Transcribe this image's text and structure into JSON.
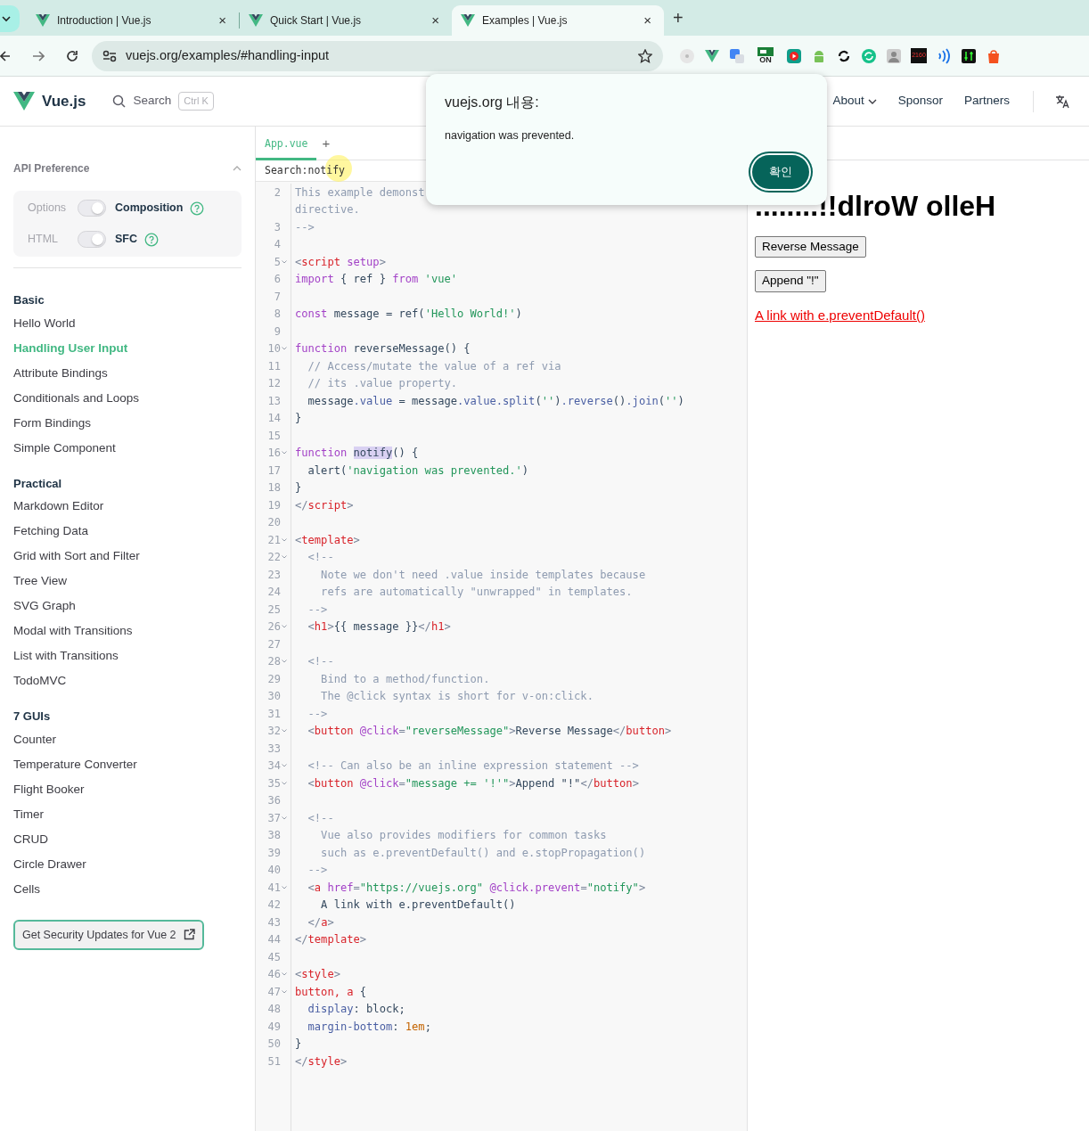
{
  "browser": {
    "tabs": [
      {
        "title": "Introduction | Vue.js",
        "selected": false
      },
      {
        "title": "Quick Start | Vue.js",
        "selected": false
      },
      {
        "title": "Examples | Vue.js",
        "selected": true
      }
    ],
    "new_tab": "+",
    "close": "×",
    "url": "vuejs.org/examples/#handling-input",
    "extension_labels": [
      "ON",
      "2160"
    ]
  },
  "header": {
    "brand": "Vue.js",
    "search": "Search",
    "shortcut": "Ctrl K",
    "nav": [
      {
        "label": "About",
        "dropdown": true
      },
      {
        "label": "Sponsor",
        "dropdown": false
      },
      {
        "label": "Partners",
        "dropdown": false
      }
    ]
  },
  "sidebar": {
    "pref_title": "API Preference",
    "prefs": [
      {
        "left": "Options",
        "right": "Composition",
        "right_selected": true
      },
      {
        "left": "HTML",
        "right": "SFC",
        "right_selected": true
      }
    ],
    "sections": [
      {
        "title": "Basic",
        "items": [
          {
            "label": "Hello World",
            "selected": false
          },
          {
            "label": "Handling User Input",
            "selected": true
          },
          {
            "label": "Attribute Bindings",
            "selected": false
          },
          {
            "label": "Conditionals and Loops",
            "selected": false
          },
          {
            "label": "Form Bindings",
            "selected": false
          },
          {
            "label": "Simple Component",
            "selected": false
          }
        ]
      },
      {
        "title": "Practical",
        "items": [
          {
            "label": "Markdown Editor",
            "selected": false
          },
          {
            "label": "Fetching Data",
            "selected": false
          },
          {
            "label": "Grid with Sort and Filter",
            "selected": false
          },
          {
            "label": "Tree View",
            "selected": false
          },
          {
            "label": "SVG Graph",
            "selected": false
          },
          {
            "label": "Modal with Transitions",
            "selected": false
          },
          {
            "label": "List with Transitions",
            "selected": false
          },
          {
            "label": "TodoMVC",
            "selected": false
          }
        ]
      },
      {
        "title": "7 GUIs",
        "items": [
          {
            "label": "Counter",
            "selected": false
          },
          {
            "label": "Temperature Converter",
            "selected": false
          },
          {
            "label": "Flight Booker",
            "selected": false
          },
          {
            "label": "Timer",
            "selected": false
          },
          {
            "label": "CRUD",
            "selected": false
          },
          {
            "label": "Circle Drawer",
            "selected": false
          },
          {
            "label": "Cells",
            "selected": false
          }
        ]
      }
    ],
    "security_button": "Get Security Updates for Vue 2"
  },
  "editor": {
    "tabs": [
      {
        "label": "App.vue",
        "selected": true
      }
    ],
    "add_tab": "+",
    "search_label": "Search:",
    "search_value": "notify",
    "lines": [
      {
        "n": "2",
        "fold": false,
        "tokens": [
          {
            "kind": "c",
            "text": "This example demonst"
          }
        ]
      },
      {
        "fold": false,
        "tokens": [
          {
            "kind": "c",
            "text": "directive."
          }
        ]
      },
      {
        "n": "3",
        "fold": false,
        "tokens": [
          {
            "kind": "c",
            "text": "-->"
          }
        ]
      },
      {
        "n": "4",
        "fold": false
      },
      {
        "n": "5",
        "fold": true,
        "tokens": [
          {
            "kind": "pu",
            "text": "<"
          },
          {
            "kind": "tag",
            "text": "script"
          },
          {
            "kind": "at",
            "text": " setup"
          },
          {
            "kind": "pu",
            "text": ">"
          }
        ]
      },
      {
        "n": "6",
        "fold": false,
        "tokens": [
          {
            "kind": "k",
            "text": "import"
          },
          {
            "kind": "p",
            "text": " { ref } "
          },
          {
            "kind": "k",
            "text": "from"
          },
          {
            "kind": "s",
            "text": " 'vue'"
          }
        ]
      },
      {
        "n": "7",
        "fold": false
      },
      {
        "n": "8",
        "fold": false,
        "tokens": [
          {
            "kind": "k",
            "text": "const"
          },
          {
            "kind": "p",
            "text": " message = ref("
          },
          {
            "kind": "s",
            "text": "'Hello World!'"
          },
          {
            "kind": "p",
            "text": ")"
          }
        ]
      },
      {
        "n": "9",
        "fold": false
      },
      {
        "n": "10",
        "fold": true,
        "tokens": [
          {
            "kind": "k",
            "text": "function"
          },
          {
            "kind": "p",
            "text": " reverseMessage() {"
          }
        ]
      },
      {
        "n": "11",
        "fold": false,
        "tokens": [
          {
            "kind": "c",
            "text": "  // Access/mutate the value of a ref via"
          }
        ]
      },
      {
        "n": "12",
        "fold": false,
        "tokens": [
          {
            "kind": "c",
            "text": "  // its .value property."
          }
        ]
      },
      {
        "n": "13",
        "fold": false,
        "tokens": [
          {
            "kind": "p",
            "text": "  message"
          },
          {
            "kind": "pr",
            "text": ".value"
          },
          {
            "kind": "p",
            "text": " = message"
          },
          {
            "kind": "pr",
            "text": ".value.split"
          },
          {
            "kind": "p",
            "text": "("
          },
          {
            "kind": "s",
            "text": "''"
          },
          {
            "kind": "p",
            "text": ")"
          },
          {
            "kind": "pr",
            "text": ".reverse"
          },
          {
            "kind": "p",
            "text": "()"
          },
          {
            "kind": "pr",
            "text": ".join"
          },
          {
            "kind": "p",
            "text": "("
          },
          {
            "kind": "s",
            "text": "''"
          },
          {
            "kind": "p",
            "text": ")"
          }
        ]
      },
      {
        "n": "14",
        "fold": false,
        "tokens": [
          {
            "kind": "p",
            "text": "}"
          }
        ]
      },
      {
        "n": "15",
        "fold": false
      },
      {
        "n": "16",
        "fold": true,
        "tokens": [
          {
            "kind": "k",
            "text": "function "
          },
          {
            "kind": "m",
            "text": "notify"
          },
          {
            "kind": "p",
            "text": "() {"
          }
        ]
      },
      {
        "n": "17",
        "fold": false,
        "tokens": [
          {
            "kind": "p",
            "text": "  alert("
          },
          {
            "kind": "s",
            "text": "'navigation was prevented.'"
          },
          {
            "kind": "p",
            "text": ")"
          }
        ]
      },
      {
        "n": "18",
        "fold": false,
        "tokens": [
          {
            "kind": "p",
            "text": "}"
          }
        ]
      },
      {
        "n": "19",
        "fold": false,
        "tokens": [
          {
            "kind": "pu",
            "text": "</"
          },
          {
            "kind": "tag",
            "text": "script"
          },
          {
            "kind": "pu",
            "text": ">"
          }
        ]
      },
      {
        "n": "20",
        "fold": false
      },
      {
        "n": "21",
        "fold": true,
        "tokens": [
          {
            "kind": "pu",
            "text": "<"
          },
          {
            "kind": "tag",
            "text": "template"
          },
          {
            "kind": "pu",
            "text": ">"
          }
        ]
      },
      {
        "n": "22",
        "fold": true,
        "tokens": [
          {
            "kind": "c",
            "text": "  <!--"
          }
        ]
      },
      {
        "n": "23",
        "fold": false,
        "tokens": [
          {
            "kind": "c",
            "text": "    Note we don't need .value inside templates because"
          }
        ]
      },
      {
        "n": "24",
        "fold": false,
        "tokens": [
          {
            "kind": "c",
            "text": "    refs are automatically \"unwrapped\" in templates."
          }
        ]
      },
      {
        "n": "25",
        "fold": false,
        "tokens": [
          {
            "kind": "c",
            "text": "  -->"
          }
        ]
      },
      {
        "n": "26",
        "fold": true,
        "tokens": [
          {
            "kind": "pu",
            "text": "  <"
          },
          {
            "kind": "tag",
            "text": "h1"
          },
          {
            "kind": "pu",
            "text": ">"
          },
          {
            "kind": "p",
            "text": "{{ message }}"
          },
          {
            "kind": "pu",
            "text": "</"
          },
          {
            "kind": "tag",
            "text": "h1"
          },
          {
            "kind": "pu",
            "text": ">"
          }
        ]
      },
      {
        "n": "27",
        "fold": false
      },
      {
        "n": "28",
        "fold": true,
        "tokens": [
          {
            "kind": "c",
            "text": "  <!--"
          }
        ]
      },
      {
        "n": "29",
        "fold": false,
        "tokens": [
          {
            "kind": "c",
            "text": "    Bind to a method/function."
          }
        ]
      },
      {
        "n": "30",
        "fold": false,
        "tokens": [
          {
            "kind": "c",
            "text": "    The @click syntax is short for v-on:click."
          }
        ]
      },
      {
        "n": "31",
        "fold": false,
        "tokens": [
          {
            "kind": "c",
            "text": "  -->"
          }
        ]
      },
      {
        "n": "32",
        "fold": true,
        "tokens": [
          {
            "kind": "pu",
            "text": "  <"
          },
          {
            "kind": "tag",
            "text": "button"
          },
          {
            "kind": "at",
            "text": " @click"
          },
          {
            "kind": "pu",
            "text": "="
          },
          {
            "kind": "s",
            "text": "\"reverseMessage\""
          },
          {
            "kind": "pu",
            "text": ">"
          },
          {
            "kind": "p",
            "text": "Reverse Message"
          },
          {
            "kind": "pu",
            "text": "</"
          },
          {
            "kind": "tag",
            "text": "button"
          },
          {
            "kind": "pu",
            "text": ">"
          }
        ]
      },
      {
        "n": "33",
        "fold": false
      },
      {
        "n": "34",
        "fold": true,
        "tokens": [
          {
            "kind": "c",
            "text": "  <!-- Can also be an inline expression statement -->"
          }
        ]
      },
      {
        "n": "35",
        "fold": true,
        "tokens": [
          {
            "kind": "pu",
            "text": "  <"
          },
          {
            "kind": "tag",
            "text": "button"
          },
          {
            "kind": "at",
            "text": " @click"
          },
          {
            "kind": "pu",
            "text": "="
          },
          {
            "kind": "s",
            "text": "\"message += '!'\""
          },
          {
            "kind": "pu",
            "text": ">"
          },
          {
            "kind": "p",
            "text": "Append \"!\""
          },
          {
            "kind": "pu",
            "text": "</"
          },
          {
            "kind": "tag",
            "text": "button"
          },
          {
            "kind": "pu",
            "text": ">"
          }
        ]
      },
      {
        "n": "36",
        "fold": false
      },
      {
        "n": "37",
        "fold": true,
        "tokens": [
          {
            "kind": "c",
            "text": "  <!--"
          }
        ]
      },
      {
        "n": "38",
        "fold": false,
        "tokens": [
          {
            "kind": "c",
            "text": "    Vue also provides modifiers for common tasks"
          }
        ]
      },
      {
        "n": "39",
        "fold": false,
        "tokens": [
          {
            "kind": "c",
            "text": "    such as e.preventDefault() and e.stopPropagation()"
          }
        ]
      },
      {
        "n": "40",
        "fold": false,
        "tokens": [
          {
            "kind": "c",
            "text": "  -->"
          }
        ]
      },
      {
        "n": "41",
        "fold": true,
        "tokens": [
          {
            "kind": "pu",
            "text": "  <"
          },
          {
            "kind": "tag",
            "text": "a"
          },
          {
            "kind": "at",
            "text": " href"
          },
          {
            "kind": "pu",
            "text": "="
          },
          {
            "kind": "s",
            "text": "\"https://vuejs.org\""
          },
          {
            "kind": "at",
            "text": " @click.prevent"
          },
          {
            "kind": "pu",
            "text": "="
          },
          {
            "kind": "s",
            "text": "\"notify\""
          },
          {
            "kind": "pu",
            "text": ">"
          }
        ]
      },
      {
        "n": "42",
        "fold": false,
        "tokens": [
          {
            "kind": "p",
            "text": "    A link with e.preventDefault()"
          }
        ]
      },
      {
        "n": "43",
        "fold": false,
        "tokens": [
          {
            "kind": "pu",
            "text": "  </"
          },
          {
            "kind": "tag",
            "text": "a"
          },
          {
            "kind": "pu",
            "text": ">"
          }
        ]
      },
      {
        "n": "44",
        "fold": false,
        "tokens": [
          {
            "kind": "pu",
            "text": "</"
          },
          {
            "kind": "tag",
            "text": "template"
          },
          {
            "kind": "pu",
            "text": ">"
          }
        ]
      },
      {
        "n": "45",
        "fold": false
      },
      {
        "n": "46",
        "fold": true,
        "tokens": [
          {
            "kind": "pu",
            "text": "<"
          },
          {
            "kind": "tag",
            "text": "style"
          },
          {
            "kind": "pu",
            "text": ">"
          }
        ]
      },
      {
        "n": "47",
        "fold": true,
        "tokens": [
          {
            "kind": "tag",
            "text": "button, a"
          },
          {
            "kind": "p",
            "text": " {"
          }
        ]
      },
      {
        "n": "48",
        "fold": false,
        "tokens": [
          {
            "kind": "pr",
            "text": "  display"
          },
          {
            "kind": "p",
            "text": ": block;"
          }
        ]
      },
      {
        "n": "49",
        "fold": false,
        "tokens": [
          {
            "kind": "pr",
            "text": "  margin-bottom"
          },
          {
            "kind": "p",
            "text": ": "
          },
          {
            "kind": "n",
            "text": "1em"
          },
          {
            "kind": "p",
            "text": ";"
          }
        ]
      },
      {
        "n": "50",
        "fold": false,
        "tokens": [
          {
            "kind": "p",
            "text": "}"
          }
        ]
      },
      {
        "n": "51",
        "fold": false,
        "tokens": [
          {
            "kind": "pu",
            "text": "</"
          },
          {
            "kind": "tag",
            "text": "style"
          },
          {
            "kind": "pu",
            "text": ">"
          }
        ]
      }
    ]
  },
  "preview": {
    "heading": "........!!dlroW olleH",
    "buttons": [
      "Reverse Message",
      "Append \"!\""
    ],
    "link": "A link with e.preventDefault()"
  },
  "dialog": {
    "title": "vuejs.org 내용:",
    "message": "navigation was prevented.",
    "ok": "확인"
  }
}
